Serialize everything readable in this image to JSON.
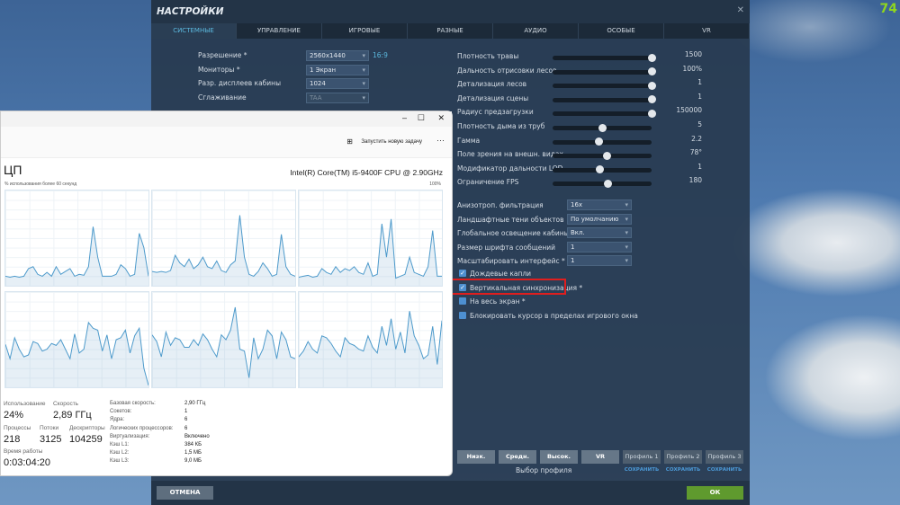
{
  "fps_counter": "74",
  "settings": {
    "title": "НАСТРОЙКИ",
    "tabs": [
      "СИСТЕМНЫЕ",
      "УПРАВЛЕНИЕ",
      "ИГРОВЫЕ",
      "РАЗНЫЕ",
      "АУДИО",
      "ОСОБЫЕ",
      "VR"
    ],
    "active_tab": "СИСТЕМНЫЕ",
    "left_selects": [
      {
        "label": "Разрешение *",
        "value": "2560x1440",
        "extra": "16:9"
      },
      {
        "label": "Мониторы *",
        "value": "1 Экран"
      },
      {
        "label": "Разр. дисплеев кабины",
        "value": "1024"
      },
      {
        "label": "Сглаживание",
        "value": "TAA",
        "disabled": true
      }
    ],
    "sliders": [
      {
        "label": "Плотность травы",
        "value": "1500",
        "fraction": 1.0
      },
      {
        "label": "Дальность отрисовки лесов",
        "value": "100%",
        "fraction": 1.0
      },
      {
        "label": "Детализация лесов",
        "value": "1",
        "fraction": 1.0
      },
      {
        "label": "Детализация сцены",
        "value": "1",
        "fraction": 1.0
      },
      {
        "label": "Радиус предзагрузки",
        "value": "150000",
        "fraction": 1.0
      },
      {
        "label": "Плотность дыма из труб",
        "value": "5",
        "fraction": 0.5
      },
      {
        "label": "Гамма",
        "value": "2.2",
        "fraction": 0.47
      },
      {
        "label": "Поле зрения на внешн. видах",
        "value": "78°",
        "fraction": 0.55
      },
      {
        "label": "Модификатор дальности LOD",
        "value": "1",
        "fraction": 0.48
      },
      {
        "label": "Ограничение FPS",
        "value": "180",
        "fraction": 0.56
      }
    ],
    "right_selects": [
      {
        "label": "Анизотроп. фильтрация",
        "value": "16x"
      },
      {
        "label": "Ландшафтные тени объектов",
        "value": "По умолчанию"
      },
      {
        "label": "Глобальное освещение кабины",
        "value": "Вкл."
      },
      {
        "label": "Размер шрифта сообщений",
        "value": "1"
      },
      {
        "label": "Масштабировать интерфейс *",
        "value": "1"
      }
    ],
    "checkboxes": [
      {
        "label": "Дождевые капли",
        "checked": true
      },
      {
        "label": "Вертикальная синхронизация *",
        "checked": true,
        "highlighted": true
      },
      {
        "label": "На весь экран *",
        "checked": false
      },
      {
        "label": "Блокировать курсор в пределах игрового окна",
        "checked": false
      }
    ],
    "presets": [
      "Низк.",
      "Средн.",
      "Высок.",
      "VR"
    ],
    "preset_caption": "Выбор профиля",
    "profiles": [
      "Профиль 1",
      "Профиль 2",
      "Профиль 3"
    ],
    "save_label": "СОХРАНИТЬ",
    "cancel_label": "ОТМЕНА",
    "ok_label": "ОК",
    "highlight_color": "#e01e1e",
    "ok_color": "#5f9a2e"
  },
  "task_manager": {
    "run_task_label": "Запустить новую задачу",
    "title": "ЦП",
    "cpu_name": "Intel(R) Core(TM) i5-9400F CPU @ 2.90GHz",
    "graph_caption": "% использования более 60 секунд",
    "graph_max": "100%",
    "stats": {
      "usage_label": "Использование",
      "usage": "24%",
      "speed_label": "Скорость",
      "speed": "2,89 ГГц",
      "processes_label": "Процессы",
      "processes": "218",
      "threads_label": "Потоки",
      "threads": "3125",
      "handles_label": "Дескрипторы",
      "handles": "104259",
      "uptime_label": "Время работы",
      "uptime": "0:03:04:20"
    },
    "details": [
      {
        "k": "Базовая скорость:",
        "v": "2,90 ГГц"
      },
      {
        "k": "Сокетов:",
        "v": "1"
      },
      {
        "k": "Ядра:",
        "v": "6"
      },
      {
        "k": "Логических процессоров:",
        "v": "6"
      },
      {
        "k": "Виртуализация:",
        "v": "Включено"
      },
      {
        "k": "Кэш L1:",
        "v": "384 КБ"
      },
      {
        "k": "Кэш L2:",
        "v": "1,5 МБ"
      },
      {
        "k": "Кэш L3:",
        "v": "9,0 МБ"
      }
    ],
    "core_usage_percent": [
      [
        10,
        9,
        10,
        9,
        10,
        18,
        20,
        12,
        10,
        14,
        10,
        20,
        12,
        15,
        18,
        10,
        12,
        11,
        20,
        62,
        30,
        10,
        10,
        10,
        12,
        22,
        18,
        10,
        12,
        55,
        40,
        10
      ],
      [
        15,
        14,
        15,
        14,
        16,
        32,
        24,
        20,
        28,
        18,
        22,
        30,
        20,
        18,
        26,
        16,
        14,
        22,
        26,
        74,
        30,
        12,
        10,
        15,
        24,
        18,
        10,
        12,
        54,
        20,
        12,
        10
      ],
      [
        9,
        10,
        11,
        9,
        10,
        18,
        14,
        12,
        20,
        14,
        18,
        16,
        20,
        14,
        12,
        24,
        10,
        12,
        65,
        30,
        70,
        8,
        10,
        12,
        30,
        14,
        12,
        10,
        20,
        58,
        10,
        10
      ],
      [
        45,
        30,
        52,
        40,
        32,
        34,
        48,
        46,
        38,
        40,
        46,
        44,
        50,
        40,
        30,
        56,
        36,
        40,
        68,
        62,
        60,
        38,
        55,
        30,
        50,
        52,
        60,
        36,
        54,
        62,
        20,
        2
      ],
      [
        55,
        48,
        32,
        58,
        44,
        52,
        50,
        42,
        42,
        50,
        44,
        56,
        50,
        40,
        32,
        55,
        50,
        60,
        84,
        40,
        38,
        10,
        52,
        30,
        40,
        60,
        54,
        30,
        58,
        50,
        32,
        30
      ],
      [
        32,
        38,
        48,
        40,
        36,
        54,
        52,
        46,
        38,
        32,
        52,
        46,
        44,
        40,
        38,
        54,
        42,
        36,
        64,
        44,
        72,
        40,
        58,
        36,
        80,
        54,
        44,
        30,
        34,
        64,
        24,
        70
      ]
    ]
  }
}
